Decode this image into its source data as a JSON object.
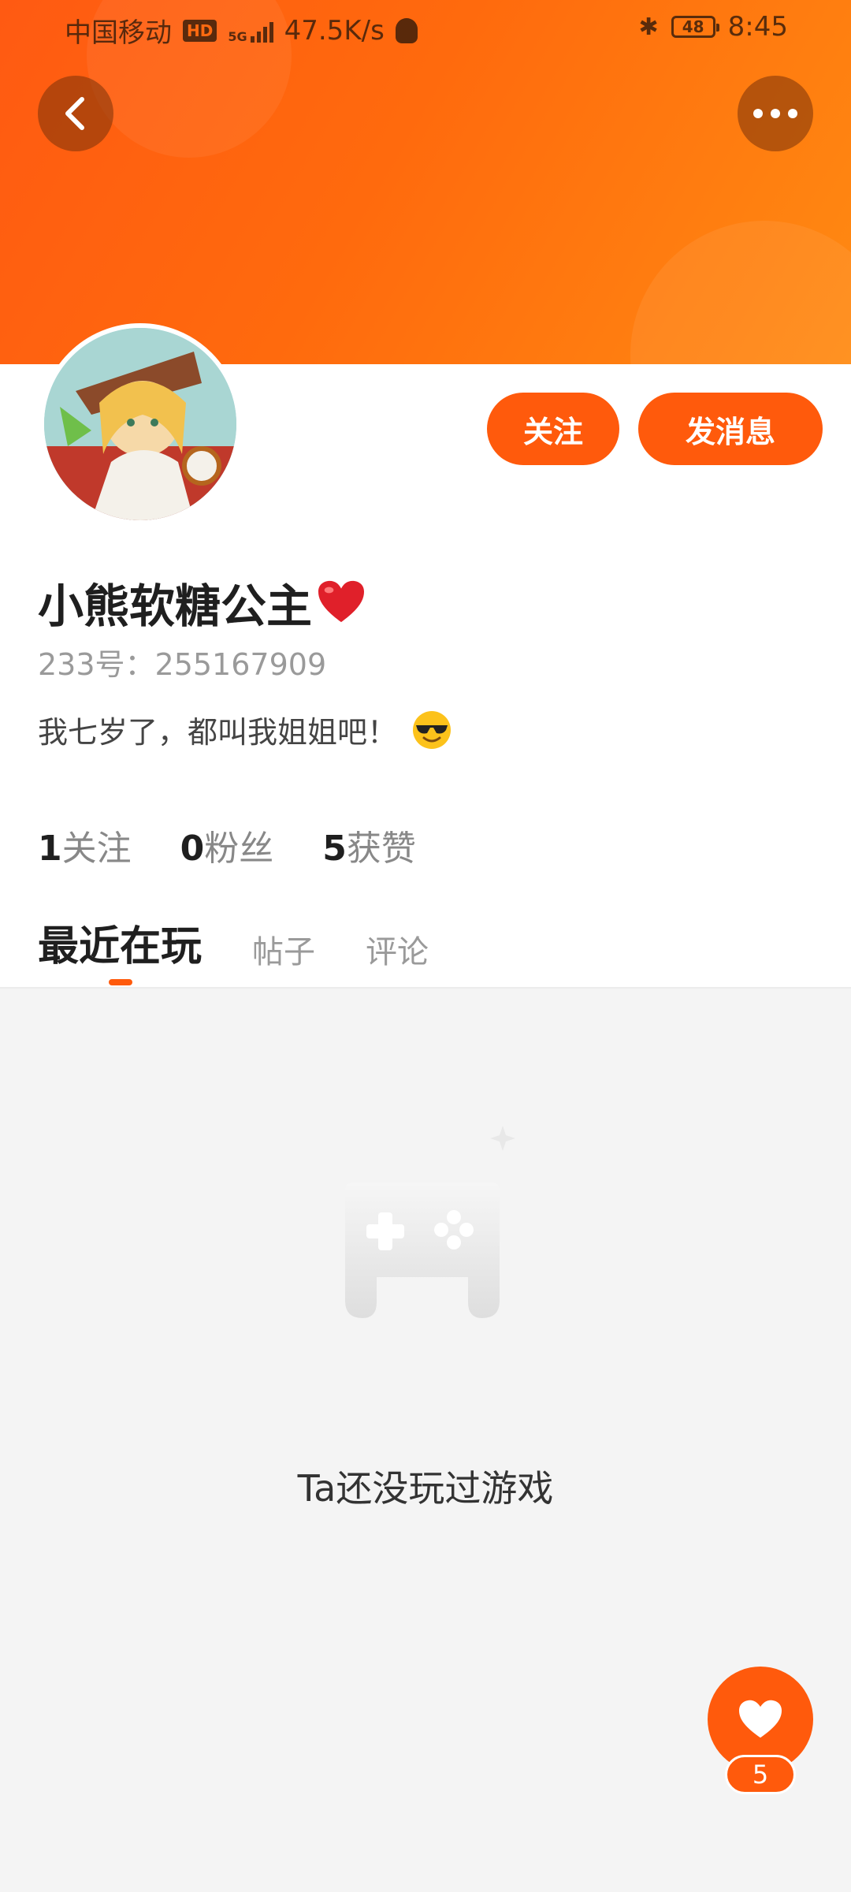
{
  "status_bar": {
    "carrier": "中国移动",
    "hd": "HD",
    "network": "5G",
    "speed": "47.5K/s",
    "battery": "48",
    "time": "8:45"
  },
  "header": {
    "back_icon": "chevron-left-icon",
    "more_icon": "more-dots-icon"
  },
  "profile": {
    "name": "小熊软糖公主",
    "name_emoji": "red-heart",
    "id_label": "233号：",
    "id_value": "255167909",
    "bio": "我七岁了，都叫我姐姐吧！",
    "bio_emoji": "sunglasses-face",
    "follow_button": "关注",
    "message_button": "发消息"
  },
  "stats": [
    {
      "value": "1",
      "label": "关注"
    },
    {
      "value": "0",
      "label": "粉丝"
    },
    {
      "value": "5",
      "label": "获赞"
    }
  ],
  "tabs": [
    {
      "label": "最近在玩",
      "active": true
    },
    {
      "label": "帖子",
      "active": false
    },
    {
      "label": "评论",
      "active": false
    }
  ],
  "empty_state": {
    "icon": "gamepad-icon",
    "text": "Ta还没玩过游戏"
  },
  "like_fab": {
    "icon": "heart-icon",
    "count": "5"
  },
  "colors": {
    "accent": "#ff5a0c",
    "banner_start": "#ff5a12",
    "banner_end": "#ff8a12",
    "page_bg": "#f4f4f4"
  }
}
